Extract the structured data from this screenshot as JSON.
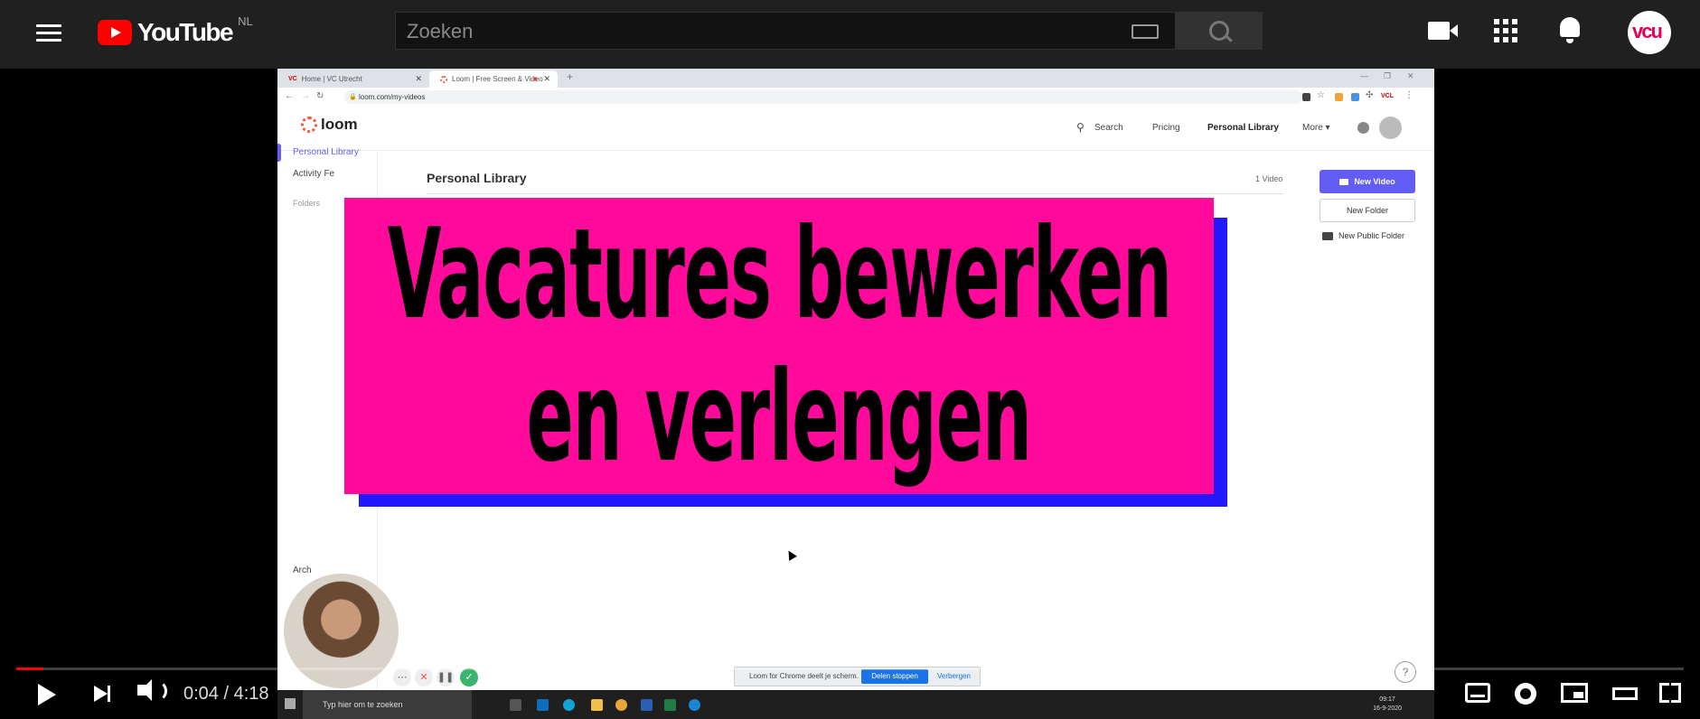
{
  "yt": {
    "logo_text": "YouTube",
    "country": "NL",
    "search_placeholder": "Zoeken",
    "avatar_text": "vcu"
  },
  "browser": {
    "tab1": "Home | VC Utrecht",
    "tab1_favicon": "VC",
    "tab2": "Loom | Free Screen & Video",
    "url": "loom.com/my-videos",
    "ext_label": "VCL"
  },
  "loom": {
    "logo": "loom",
    "nav": {
      "search": "Search",
      "pricing": "Pricing",
      "library": "Personal Library",
      "more": "More ▾"
    },
    "sidebar": {
      "personal_library": "Personal Library",
      "activity": "Activity Fe",
      "folders": "Folders",
      "archive": "Arch"
    },
    "page_title": "Personal Library",
    "video_count": "1 Video",
    "new_video": "New Video",
    "new_folder": "New Folder",
    "new_public_folder": "New Public Folder",
    "share_text": "Loom for Chrome deelt je scherm.",
    "share_stop": "Delen stoppen",
    "share_hide": "Verbergen",
    "help": "?"
  },
  "overlay": {
    "line1": "Vacatures bewerken",
    "line2": "en verlengen"
  },
  "taskbar": {
    "search": "Typ hier om te zoeken",
    "time": "09:17",
    "date": "16-9-2020"
  },
  "player": {
    "time_current": "0:04",
    "time_sep": " / ",
    "time_total": "4:18",
    "progress_fraction": 0.016
  }
}
